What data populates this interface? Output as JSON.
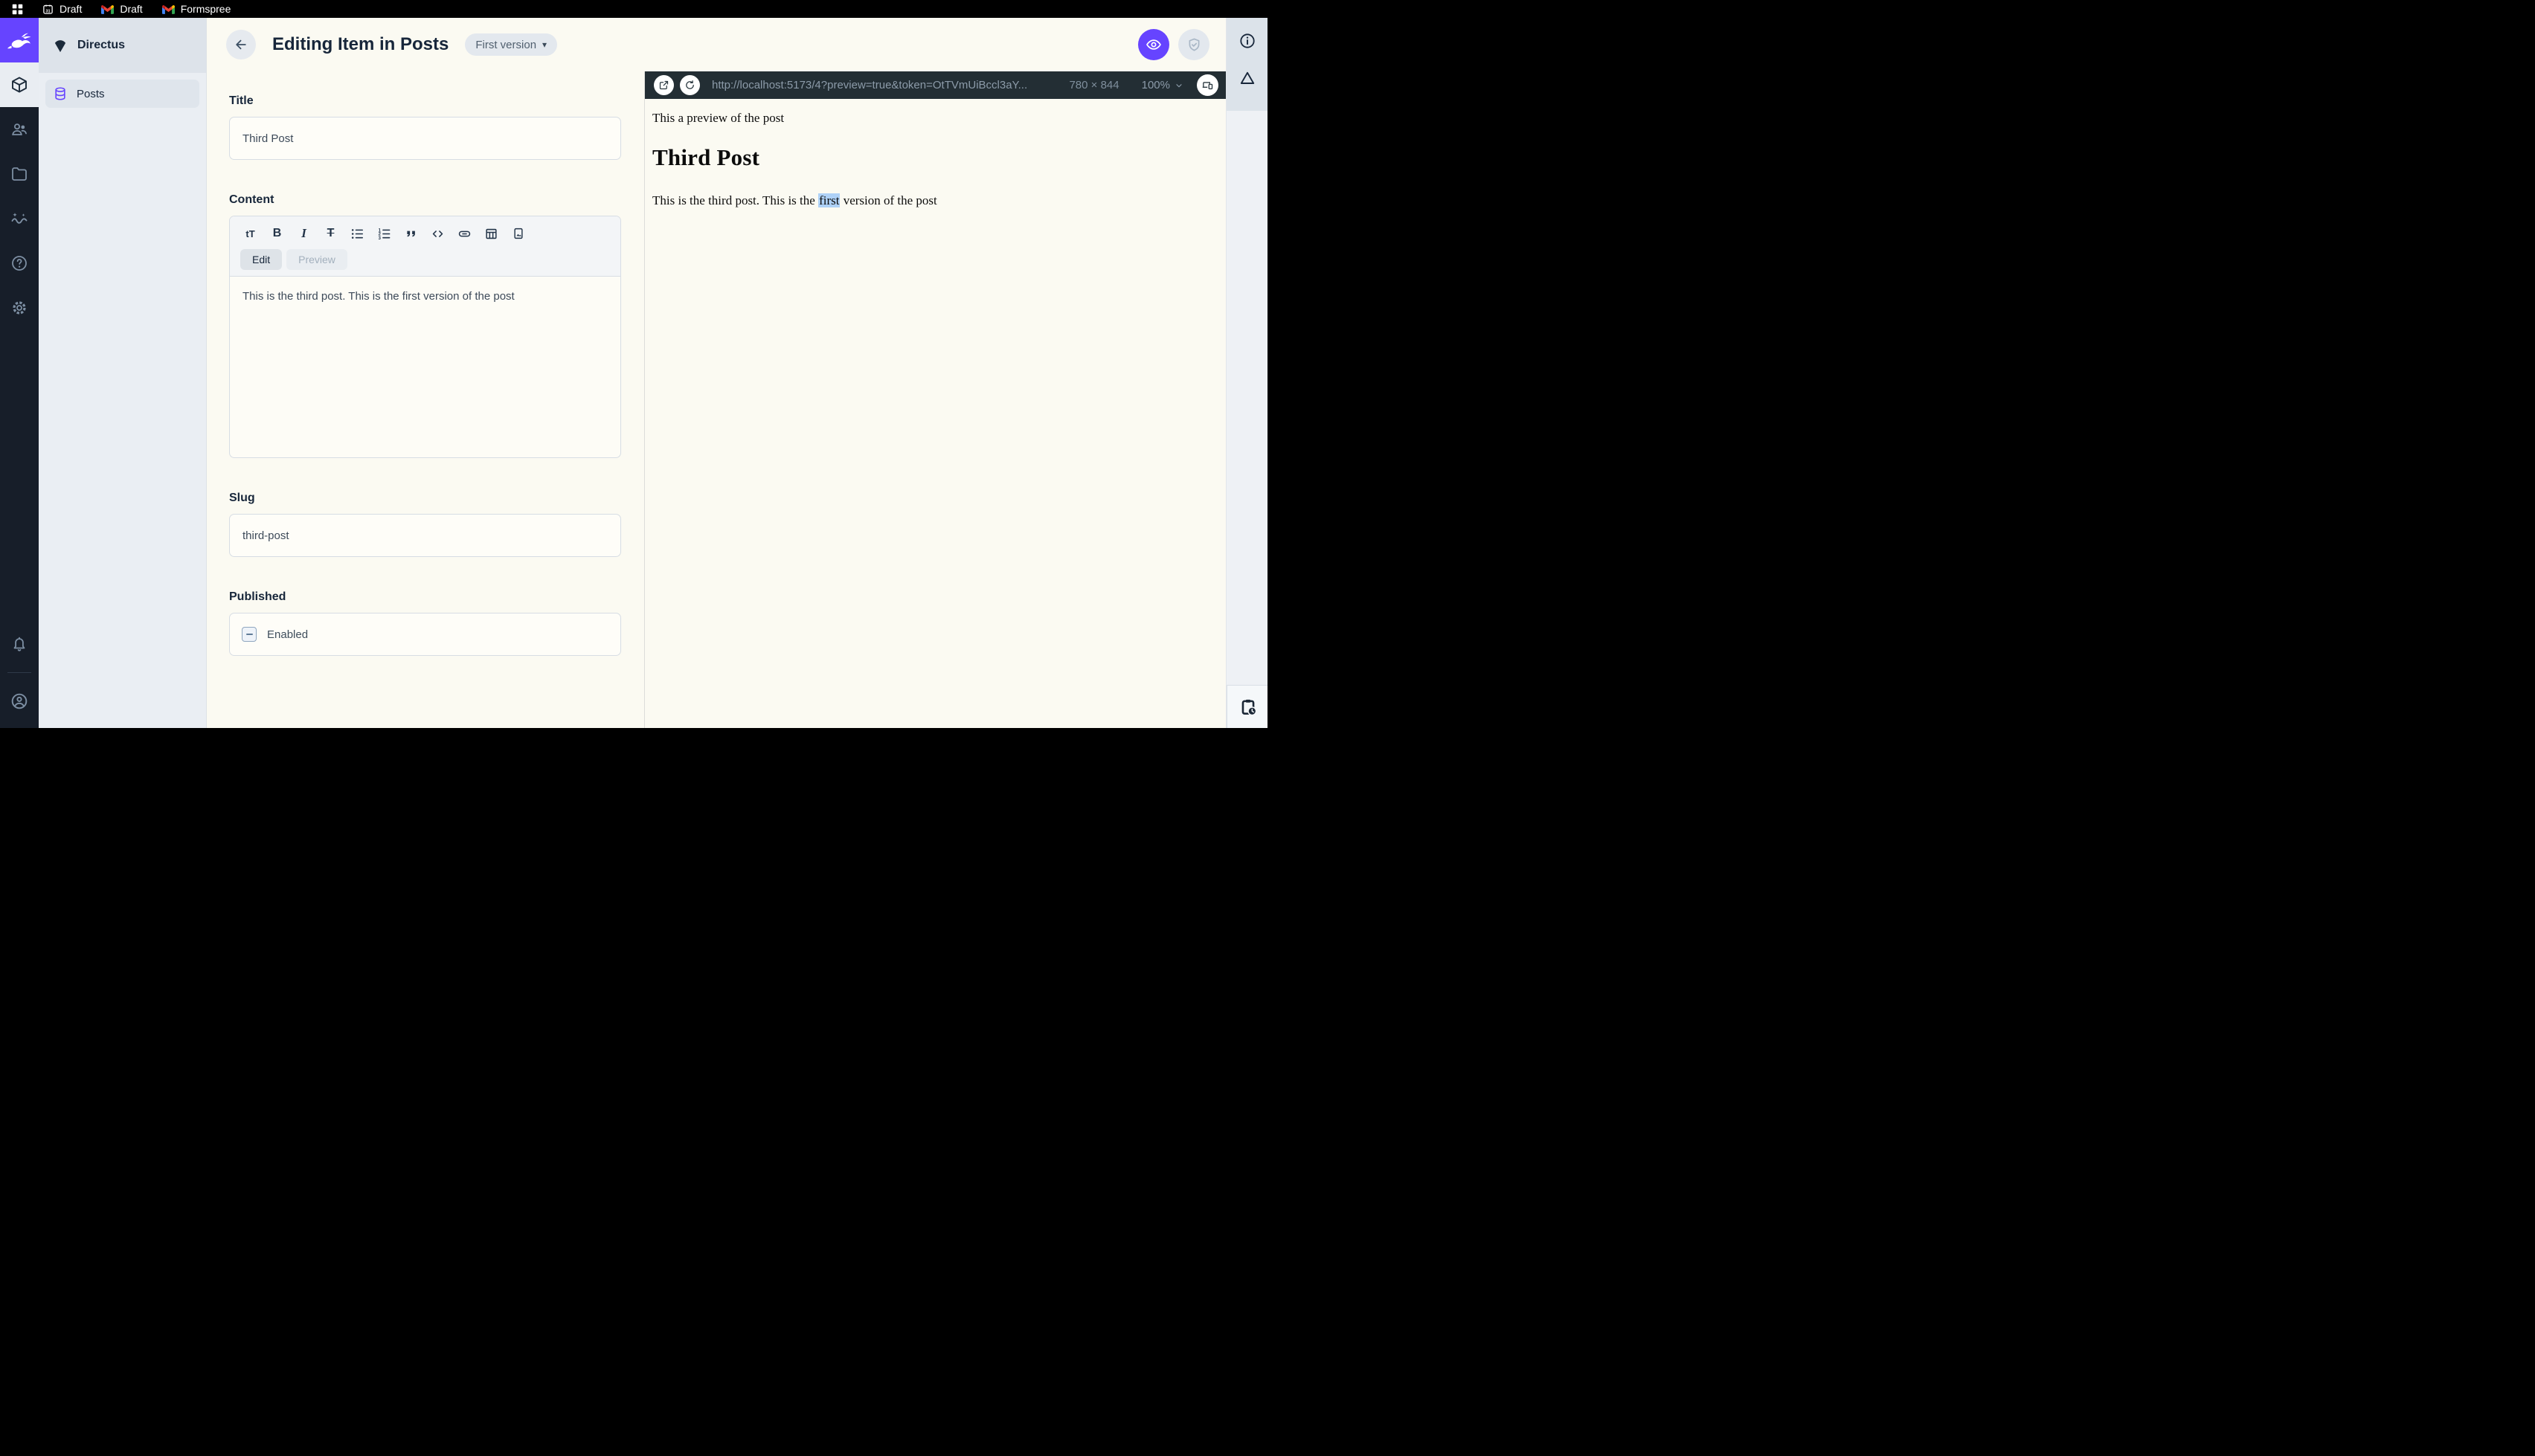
{
  "browser_topbar": {
    "tabs": [
      {
        "icon": "calendar-icon",
        "label": "Draft"
      },
      {
        "icon": "gmail-icon",
        "label": "Draft"
      },
      {
        "icon": "gmail-icon",
        "label": "Formspree"
      }
    ]
  },
  "module_bar": {
    "icons": [
      "directus-rabbit-logo",
      "content-cube",
      "users",
      "files-folder",
      "insights",
      "help",
      "settings",
      "notifications-bell",
      "account-avatar"
    ],
    "active_module": "content"
  },
  "nav": {
    "project_name": "Directus",
    "items": [
      {
        "label": "Posts",
        "icon": "database-icon",
        "active": true
      }
    ]
  },
  "header": {
    "title": "Editing Item in Posts",
    "version_label": "First version",
    "action_icons": [
      "eye-preview",
      "shield-check-save"
    ]
  },
  "form": {
    "title": {
      "label": "Title",
      "value": "Third Post"
    },
    "content": {
      "label": "Content",
      "toolbar_icons": [
        "text-size",
        "bold",
        "italic",
        "strikethrough",
        "bullet-list",
        "ordered-list",
        "blockquote",
        "code",
        "link",
        "table",
        "image"
      ],
      "tabs": [
        {
          "label": "Edit",
          "active": true
        },
        {
          "label": "Preview",
          "active": false
        }
      ],
      "value": "This is the third post. This is the first version of the post"
    },
    "slug": {
      "label": "Slug",
      "value": "third-post"
    },
    "published": {
      "label": "Published",
      "checkbox_label": "Enabled",
      "checkbox_state": "indeterminate"
    }
  },
  "preview": {
    "url": "http://localhost:5173/4?preview=true&token=OtTVmUiBccl3aY...",
    "dimensions": "780 × 844",
    "zoom_level": "100%",
    "toolbar_icons": [
      "open-in-new",
      "refresh",
      "responsive-devices"
    ],
    "content": {
      "intro": "This a preview of the post",
      "heading": "Third Post",
      "body_before": "This is the third post. This is the ",
      "body_highlight": "first",
      "body_after": " version of the post"
    }
  },
  "right_sidebar": {
    "icons": [
      "info",
      "warning-triangle",
      "clipboard-clock"
    ]
  },
  "colors": {
    "accent": "#6644ff",
    "module_bar_bg": "#171e29",
    "preview_toolbar_bg": "#232e34",
    "highlight": "#aed1f7",
    "content_bg": "#fbfaf2"
  }
}
